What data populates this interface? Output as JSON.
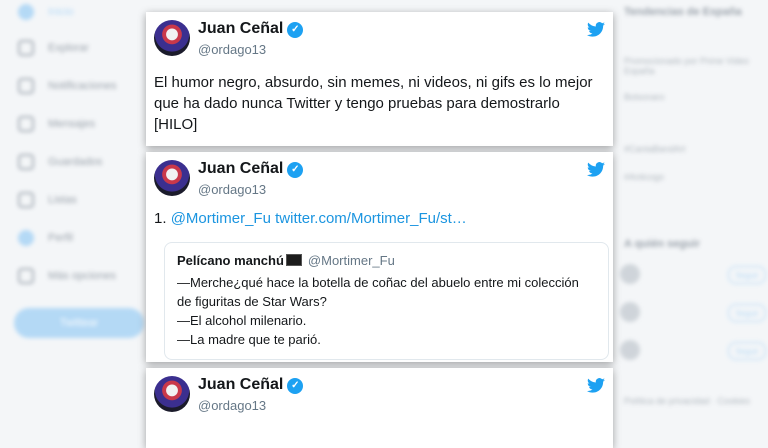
{
  "nav": {
    "items": [
      {
        "label": "Inicio",
        "active": true
      },
      {
        "label": "Explorar"
      },
      {
        "label": "Notificaciones"
      },
      {
        "label": "Mensajes"
      },
      {
        "label": "Guardados"
      },
      {
        "label": "Listas"
      },
      {
        "label": "Perfil"
      },
      {
        "label": "Más opciones"
      }
    ],
    "tweet_button": "Twittear"
  },
  "right_panel": {
    "trends_title": "Tendencias de España",
    "trend_lines": [
      "Promocionado por Prime Video España",
      "Bolsonaro",
      "#CantaBandArt",
      "#Anticogo"
    ],
    "follow_title": "A quién seguir",
    "follow_button": "Seguir",
    "footer": "Política de privacidad · Cookies"
  },
  "colors": {
    "accent": "#1da1f2",
    "link": "#1b95e0"
  },
  "tweets": [
    {
      "name": "Juan Ceñal",
      "handle": "@ordago13",
      "text": "El humor negro, absurdo, sin memes, ni videos, ni gifs es lo mejor que ha dado nunca Twitter y tengo pruebas para demostrarlo [HILO]"
    },
    {
      "name": "Juan Ceñal",
      "handle": "@ordago13",
      "number": "1.",
      "mention": "@Mortimer_Fu",
      "url": "twitter.com/Mortimer_Fu/st…",
      "quote": {
        "name": "Pelícano manchú",
        "handle": "@Mortimer_Fu",
        "lines": [
          "—Merche¿qué hace la botella de coñac del abuelo entre mi colección",
          "de figuritas de Star Wars?",
          "—El alcohol milenario.",
          "—La madre que te parió."
        ]
      }
    },
    {
      "name": "Juan Ceñal",
      "handle": "@ordago13"
    }
  ]
}
